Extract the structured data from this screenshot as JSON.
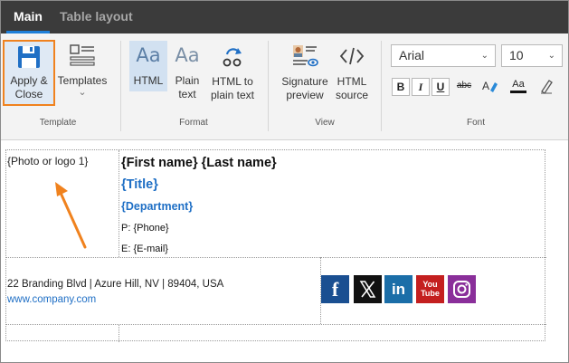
{
  "tabs": [
    {
      "label": "Main"
    },
    {
      "label": "Table layout"
    }
  ],
  "ribbon": {
    "template_group": {
      "label": "Template",
      "apply_close": {
        "line1": "Apply &",
        "line2": "Close"
      },
      "templates": {
        "label": "Templates",
        "chevron": "⌄"
      }
    },
    "format_group": {
      "label": "Format",
      "html": {
        "icon_text": "Aa",
        "label": "HTML"
      },
      "plain": {
        "icon_text": "Aa",
        "line1": "Plain",
        "line2": "text"
      },
      "html_to_plain": {
        "line1": "HTML to",
        "line2": "plain text"
      }
    },
    "view_group": {
      "label": "View",
      "signature_preview": {
        "line1": "Signature",
        "line2": "preview"
      },
      "html_source": {
        "line1": "HTML",
        "line2": "source"
      }
    },
    "font_group": {
      "label": "Font",
      "font_name": "Arial",
      "font_size": "10",
      "bold": "B",
      "italic": "I",
      "underline": "U",
      "strike": "abc",
      "font_color_sample": "Aa"
    }
  },
  "signature": {
    "photo": "{Photo or logo 1}",
    "name": "{First name} {Last name}",
    "title": "{Title}",
    "department": "{Department}",
    "phone": "P: {Phone}",
    "email": "E: {E-mail}",
    "address": "22 Branding Blvd | Azure Hill, NV | 89404, USA",
    "website": "www.company.com",
    "social": [
      {
        "icon": "facebook-icon",
        "glyph": "f"
      },
      {
        "icon": "x-icon",
        "glyph": "X"
      },
      {
        "icon": "linkedin-icon",
        "glyph": "in"
      },
      {
        "icon": "youtube-icon",
        "glyph_line1": "You",
        "glyph_line2": "Tube"
      },
      {
        "icon": "instagram-icon",
        "glyph": ""
      }
    ]
  },
  "colors": {
    "tab_bar": "#3b3b3b",
    "accent_blue": "#1e7fd8",
    "highlight_orange": "#f0821e",
    "link_blue": "#1f6fc5"
  }
}
